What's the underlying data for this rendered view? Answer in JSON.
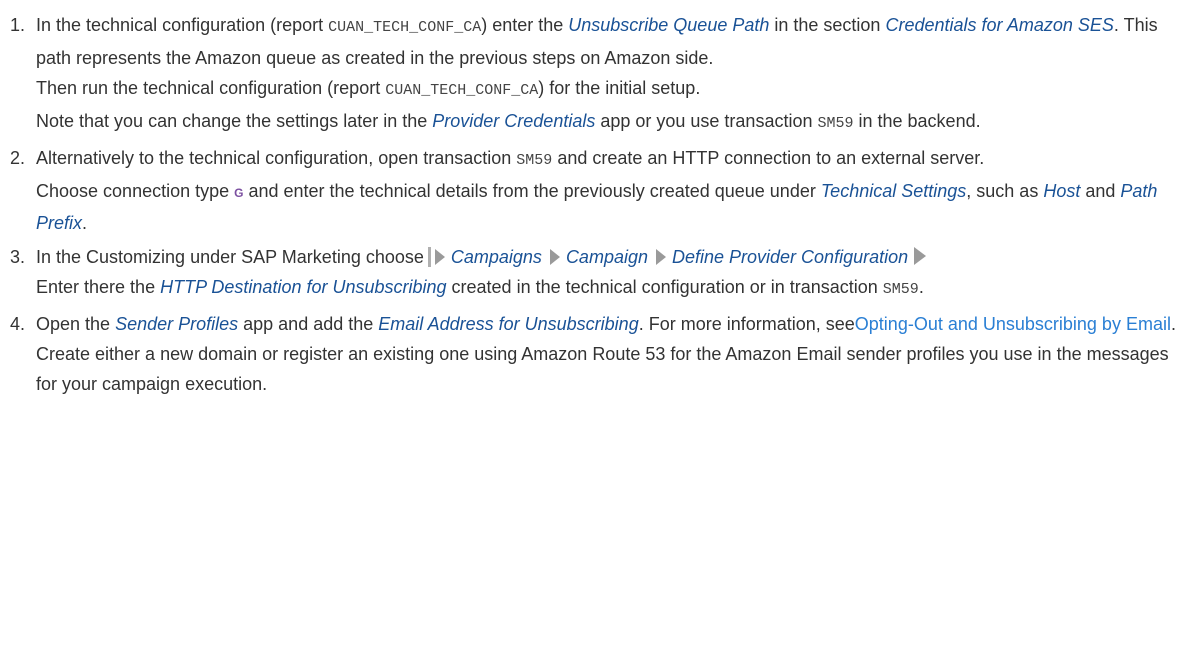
{
  "steps": [
    {
      "num": "1.",
      "p1_a": "In the technical configuration (report ",
      "p1_code": "CUAN_TECH_CONF_CA",
      "p1_b": ") enter the ",
      "p1_it1": "Unsubscribe Queue Path",
      "p1_c": " in the section ",
      "p1_it2": "Credentials for Amazon SES",
      "p1_d": ". This path represents the Amazon queue as created in the previous steps on Amazon side.",
      "p2_a": "Then run the technical configuration (report ",
      "p2_code": "CUAN_TECH_CONF_CA",
      "p2_b": ") for the initial setup.",
      "p3_a": "Note that you can change the settings later in the ",
      "p3_it": "Provider Credentials",
      "p3_b": " app or you use transaction ",
      "p3_code": "SM59",
      "p3_c": " in the backend."
    },
    {
      "num": "2.",
      "p1_a": "Alternatively to the technical configuration, open transaction ",
      "p1_code": "SM59",
      "p1_b": " and create an HTTP connection to an external server.",
      "p2_a": "Choose connection type ",
      "p2_key": "G",
      "p2_b": " and enter the technical details from the previously created queue under ",
      "p2_it1": "Technical Settings",
      "p2_c": ", such as ",
      "p2_it2": "Host",
      "p2_d": " and ",
      "p2_it3": "Path Prefix",
      "p2_e": "."
    },
    {
      "num": "3.",
      "p1_a": "In the Customizing under SAP Marketing choose",
      "path": [
        "Campaigns",
        "Campaign",
        "Define Provider Configuration"
      ],
      "p2_a": "Enter there the ",
      "p2_it": "HTTP Destination for Unsubscribing",
      "p2_b": " created in the technical configuration or in transaction ",
      "p2_code": "SM59",
      "p2_c": "."
    },
    {
      "num": "4.",
      "p1_a": "Open the ",
      "p1_it1": "Sender Profiles",
      "p1_b": " app and add the ",
      "p1_it2": "Email Address for Unsubscribing",
      "p1_c": ". For more information, see",
      "p1_link": "Opting-Out and Unsubscribing by Email",
      "p1_d": ".",
      "p2_a": "Create either a new domain or register an existing one using Amazon Route 53 for the Amazon Email sender profiles you use in the messages for your campaign execution."
    }
  ]
}
